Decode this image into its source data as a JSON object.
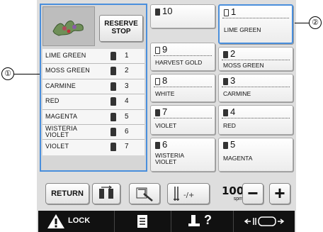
{
  "reserve_stop": "RESERVE\nSTOP",
  "thread_list": [
    {
      "name": "LIME GREEN",
      "num": "1"
    },
    {
      "name": "MOSS GREEN",
      "num": "2"
    },
    {
      "name": "CARMINE",
      "num": "3"
    },
    {
      "name": "RED",
      "num": "4"
    },
    {
      "name": "MAGENTA",
      "num": "5"
    },
    {
      "name": "WISTERIA\nVIOLET",
      "num": "6"
    },
    {
      "name": "VIOLET",
      "num": "7"
    }
  ],
  "grid": {
    "b10": {
      "num": "10",
      "label": ""
    },
    "b1": {
      "num": "1",
      "label": "LIME GREEN"
    },
    "b9": {
      "num": "9",
      "label": "HARVEST GOLD"
    },
    "b2": {
      "num": "2",
      "label": "MOSS GREEN"
    },
    "b8": {
      "num": "8",
      "label": "WHITE"
    },
    "b3": {
      "num": "3",
      "label": "CARMINE"
    },
    "b7": {
      "num": "7",
      "label": "VIOLET"
    },
    "b4": {
      "num": "4",
      "label": "RED"
    },
    "b6": {
      "num": "6",
      "label": "WISTERIA\nVIOLET"
    },
    "b5": {
      "num": "5",
      "label": "MAGENTA"
    }
  },
  "toolbar": {
    "return_label": "RETURN",
    "speed_value": "1000",
    "speed_unit": "spm",
    "minus": "−",
    "plus": "+"
  },
  "bottom": {
    "lock_label": "LOCK",
    "help_label": "?"
  },
  "callouts": {
    "c1": "①",
    "c2": "②"
  },
  "colors": {
    "highlight": "#4a8fdc",
    "bottom_bar": "#111111"
  }
}
